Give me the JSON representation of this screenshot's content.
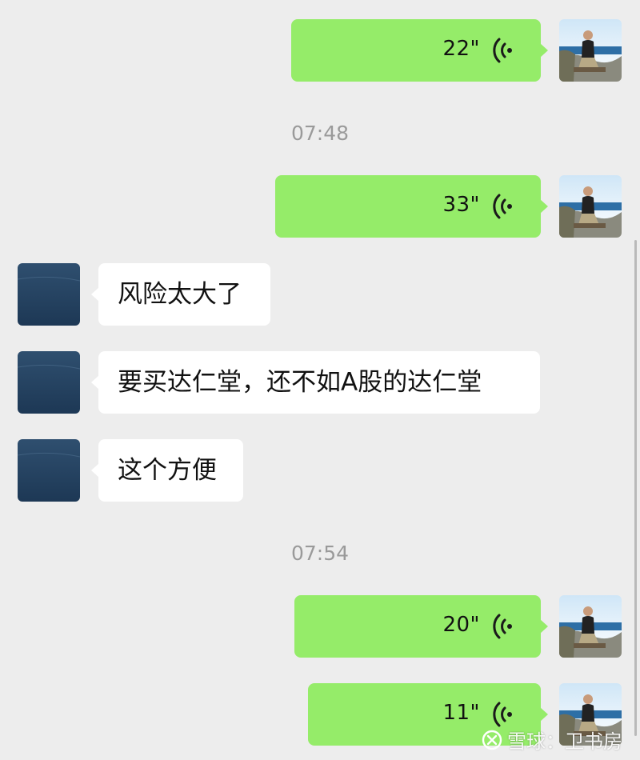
{
  "colors": {
    "background": "#ededed",
    "sent_bubble": "#95ec69",
    "received_bubble": "#ffffff",
    "timestamp": "#9a9a9a"
  },
  "icons": {
    "voice": "voice-wave-icon",
    "watermark": "snowball-logo-icon"
  },
  "messages": [
    {
      "type": "voice",
      "direction": "sent",
      "duration": "22\""
    },
    {
      "type": "timestamp",
      "text": "07:48"
    },
    {
      "type": "voice",
      "direction": "sent",
      "duration": "33\""
    },
    {
      "type": "text",
      "direction": "received",
      "text": "风险太大了"
    },
    {
      "type": "text",
      "direction": "received",
      "text": "要买达仁堂，还不如A股的达仁堂"
    },
    {
      "type": "text",
      "direction": "received",
      "text": "这个方便"
    },
    {
      "type": "timestamp",
      "text": "07:54"
    },
    {
      "type": "voice",
      "direction": "sent",
      "duration": "20\""
    },
    {
      "type": "voice",
      "direction": "sent",
      "duration": "11\""
    }
  ],
  "watermark": {
    "text": "雪球：卫书房"
  }
}
